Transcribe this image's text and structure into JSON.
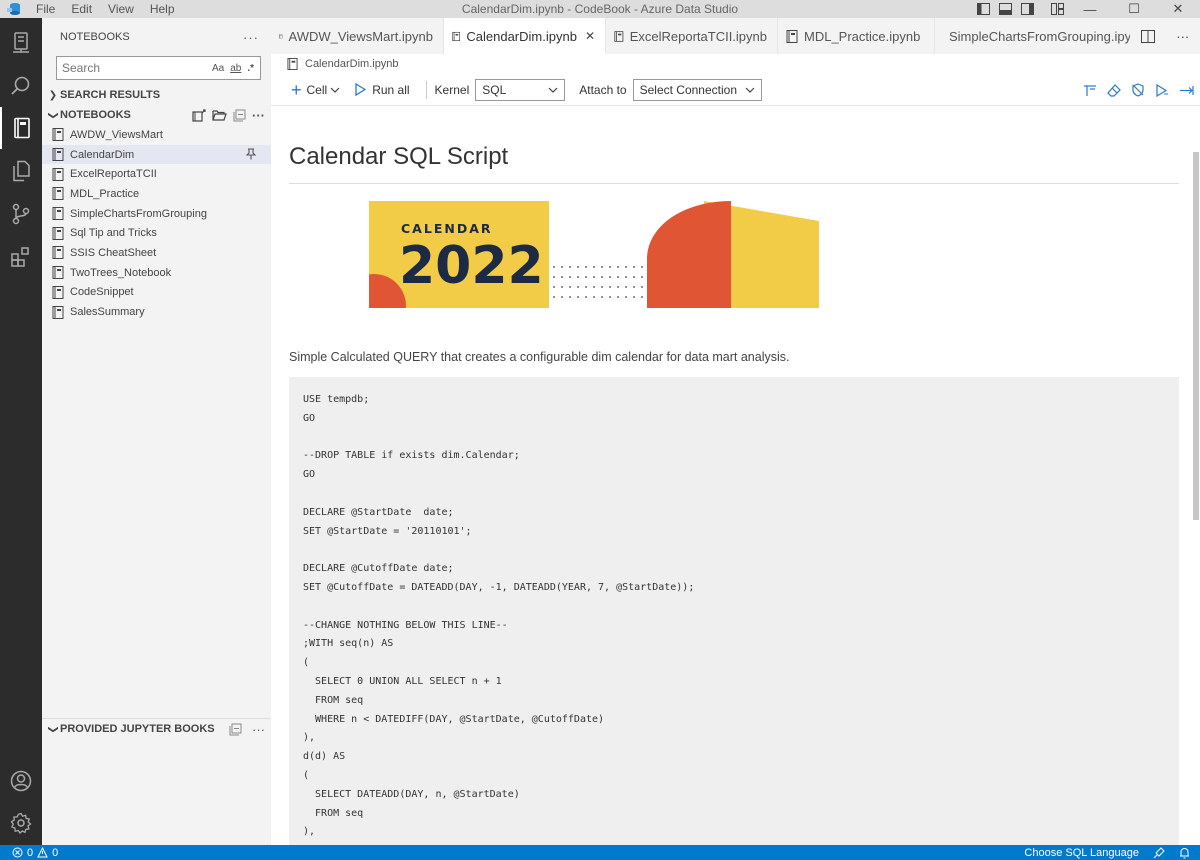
{
  "titlebar": {
    "menu": [
      "File",
      "Edit",
      "View",
      "Help"
    ],
    "title": "CalendarDim.ipynb - CodeBook - Azure Data Studio",
    "minimize": "—",
    "maximize": "☐",
    "close": "✕"
  },
  "activity": {
    "icons": [
      "server-icon",
      "search-icon",
      "notebooks-icon",
      "explorer-icon",
      "source-control-icon",
      "extensions-icon",
      "account-icon",
      "settings-gear-icon"
    ]
  },
  "sidebar": {
    "header": "NOTEBOOKS",
    "more": "···",
    "search": {
      "placeholder": "Search",
      "match_case": "Aa",
      "whole_word": "ab",
      "regex": ".*"
    },
    "search_results_label": "SEARCH RESULTS",
    "notebooks_label": "NOTEBOOKS",
    "notebooks": [
      "AWDW_ViewsMart",
      "CalendarDim",
      "ExcelReportaTCII",
      "MDL_Practice",
      "SimpleChartsFromGrouping",
      "Sql Tip and Tricks",
      "SSIS CheatSheet",
      "TwoTrees_Notebook",
      "CodeSnippet",
      "SalesSummary"
    ],
    "selected_index": 1,
    "provided_label": "PROVIDED JUPYTER BOOKS"
  },
  "tabs": [
    {
      "label": "AWDW_ViewsMart.ipynb",
      "active": false
    },
    {
      "label": "CalendarDim.ipynb",
      "active": true
    },
    {
      "label": "ExcelReportaTCII.ipynb",
      "active": false
    },
    {
      "label": "MDL_Practice.ipynb",
      "active": false
    },
    {
      "label": "SimpleChartsFromGrouping.ipynb",
      "active": false
    }
  ],
  "editor": {
    "breadcrumb": "CalendarDim.ipynb",
    "toolbar": {
      "cell_label": "Cell",
      "run_all_label": "Run all",
      "kernel_label": "Kernel",
      "kernel_value": "SQL",
      "attach_label": "Attach to",
      "attach_value": "Select Connection"
    },
    "markdown": {
      "title": "Calendar SQL Script",
      "banner_top": "CALENDAR",
      "banner_year": "2022",
      "description": "Simple Calculated QUERY that creates a configurable dim calendar for data mart analysis."
    },
    "code_lines": [
      "USE tempdb;",
      "GO",
      "",
      "--DROP TABLE if exists dim.Calendar;",
      "GO",
      "",
      "DECLARE @StartDate  date;",
      "SET @StartDate = '20110101';",
      "",
      "DECLARE @CutoffDate date;",
      "SET @CutoffDate = DATEADD(DAY, -1, DATEADD(YEAR, 7, @StartDate));",
      "",
      "--CHANGE NOTHING BELOW THIS LINE--",
      ";WITH seq(n) AS",
      "(",
      "  SELECT 0 UNION ALL SELECT n + 1",
      "  FROM seq",
      "  WHERE n < DATEDIFF(DAY, @StartDate, @CutoffDate)",
      "),",
      "d(d) AS",
      "(",
      "  SELECT DATEADD(DAY, n, @StartDate)",
      "  FROM seq",
      "),"
    ]
  },
  "statusbar": {
    "errors": "0",
    "warnings": "0",
    "language": "Choose SQL Language"
  },
  "colors": {
    "accent": "#007acc",
    "activity_bg": "#2c2c2c",
    "selection": "#e4e6f1",
    "banner_yellow": "#f2cc46",
    "banner_navy": "#1c2a44",
    "banner_red": "#e05533"
  }
}
